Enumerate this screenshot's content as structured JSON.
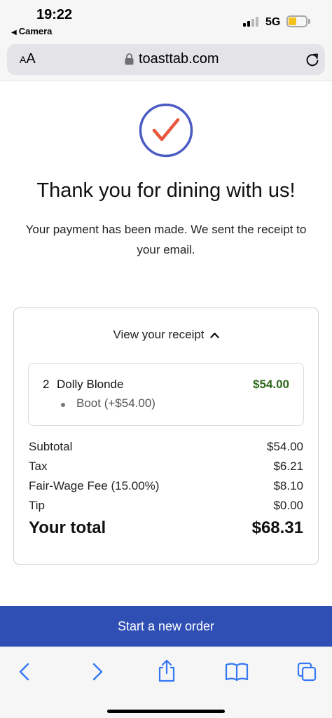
{
  "status_bar": {
    "time": "19:22",
    "back_app": "Camera",
    "network": "5G",
    "battery_level": 0.45,
    "battery_color": "#f3c21b"
  },
  "browser": {
    "text_size_label_small": "A",
    "text_size_label_large": "A",
    "url": "toasttab.com",
    "lock_icon": "lock-icon",
    "reload_icon": "reload-icon"
  },
  "confirmation": {
    "icon": "check-circle-icon",
    "title": "Thank you for dining with us!",
    "subtitle": "Your payment has been made. We sent the receipt to your email."
  },
  "receipt": {
    "toggle_label": "View your receipt",
    "items": [
      {
        "qty": "2",
        "name": "Dolly Blonde",
        "price": "$54.00",
        "modifier": "Boot (+$54.00)"
      }
    ],
    "lines": {
      "subtotal": {
        "label": "Subtotal",
        "value": "$54.00"
      },
      "tax": {
        "label": "Tax",
        "value": "$6.21"
      },
      "fee": {
        "label": "Fair-Wage Fee (15.00%)",
        "value": "$8.10"
      },
      "tip": {
        "label": "Tip",
        "value": "$0.00"
      },
      "total": {
        "label": "Your total",
        "value": "$68.31"
      }
    }
  },
  "actions": {
    "start_order_label": "Start a new order"
  },
  "colors": {
    "accent_blue": "#2f4fb5",
    "check_orange": "#e8553a",
    "circle_blue": "#4a5bc4",
    "price_green": "#2f6a1d"
  }
}
